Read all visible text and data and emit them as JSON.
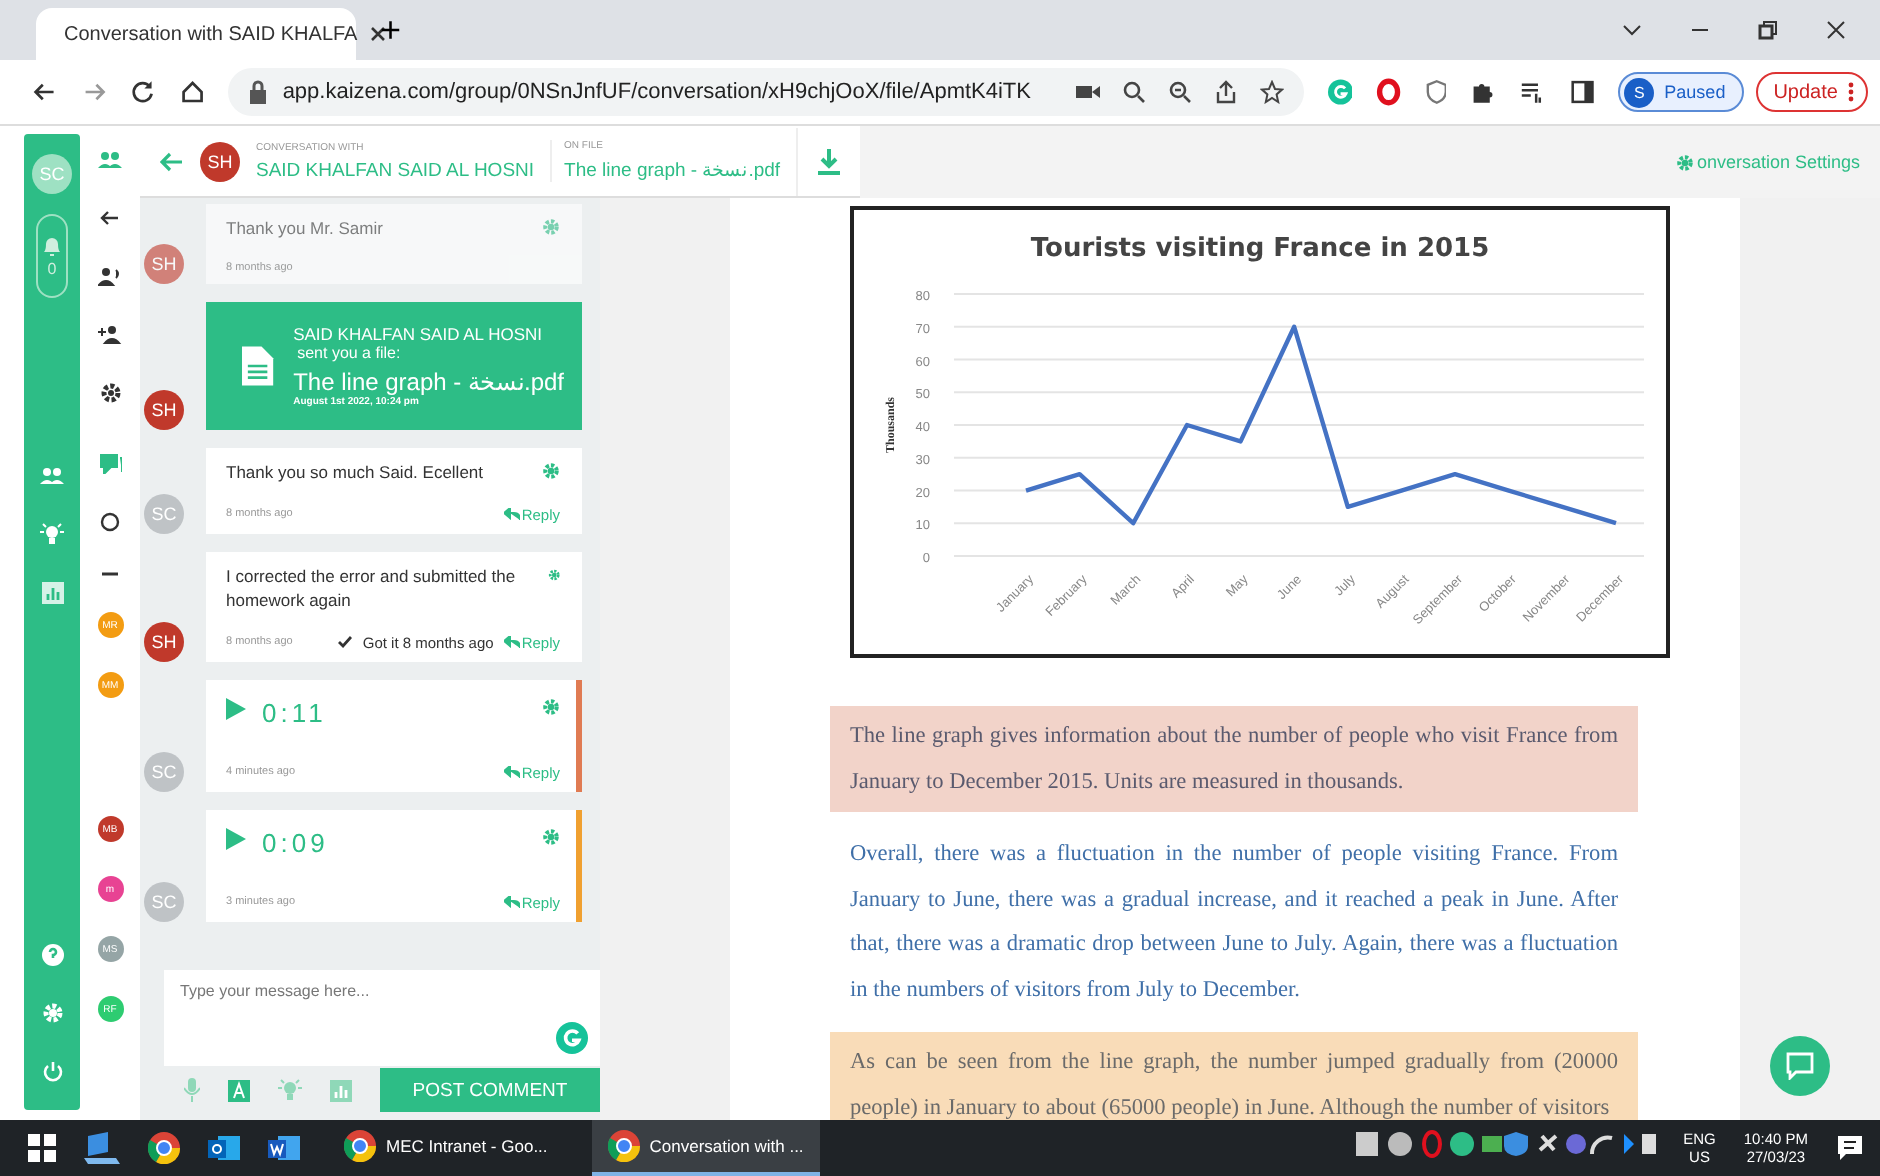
{
  "browser": {
    "tab_title": "Conversation with SAID KHALFA",
    "new_tab": "+",
    "url": "app.kaizena.com/group/0NSnJnfUF/conversation/xH9chjOoX/file/ApmtK4iTK",
    "profile_initial": "S",
    "profile_status": "Paused",
    "update": "Update"
  },
  "rail": {
    "avatar": "SC",
    "notification_count": "0"
  },
  "header": {
    "avatar": "SH",
    "with_label": "CONVERSATION WITH",
    "name": "SAID KHALFAN SAID AL HOSNI",
    "file_label": "ON FILE",
    "file": "The line graph - نسخة.pdf",
    "settings": "onversation Settings"
  },
  "members": [
    {
      "initials": "MR",
      "color": "#f39c12"
    },
    {
      "initials": "MM",
      "color": "#f39c12"
    },
    {
      "initials": "MB",
      "color": "#c0392b"
    },
    {
      "initials": "m",
      "color": "#e84393"
    },
    {
      "initials": "MS",
      "color": "#95a5a6"
    },
    {
      "initials": "RF",
      "color": "#2ecc71"
    }
  ],
  "messages": [
    {
      "kind": "text",
      "avatar": "SH",
      "faded": true,
      "text": "Thank you Mr. Samir",
      "time": "8 months ago"
    },
    {
      "kind": "file",
      "avatar": "SH",
      "sender": "SAID KHALFAN SAID AL HOSNI",
      "action": "sent you a file:",
      "file": "The line graph - نسخة.pdf",
      "date": "August 1st 2022, 10:24 pm"
    },
    {
      "kind": "text",
      "avatar": "SC",
      "faded": false,
      "text": "Thank you so much Said. Ecellent",
      "time": "8 months ago",
      "reply": "Reply"
    },
    {
      "kind": "text",
      "avatar": "SH",
      "faded": false,
      "text": "I corrected the error and submitted the homework again",
      "time": "8 months ago",
      "status": "Got it 8 months ago",
      "reply": "Reply"
    },
    {
      "kind": "audio",
      "avatar": "SC",
      "duration": "0:11",
      "time": "4 minutes ago",
      "reply": "Reply",
      "color": "#e07b53"
    },
    {
      "kind": "audio",
      "avatar": "SC",
      "duration": "0:09",
      "time": "3 minutes ago",
      "reply": "Reply",
      "color": "#f0a030"
    }
  ],
  "composer": {
    "placeholder": "Type your message here...",
    "post": "POST COMMENT"
  },
  "document": {
    "chart_data": {
      "type": "line",
      "title": "Tourists visiting France in 2015",
      "ylabel": "Thousands",
      "categories": [
        "January",
        "February",
        "March",
        "April",
        "May",
        "June",
        "July",
        "August",
        "September",
        "October",
        "November",
        "December"
      ],
      "grid": true,
      "series": [
        {
          "color": "#4472c4",
          "values": [
            20,
            25,
            10,
            40,
            35,
            70,
            15,
            20,
            25,
            20,
            15,
            10
          ]
        }
      ],
      "ylim": [
        0,
        80
      ],
      "yticks": [
        0,
        10,
        20,
        30,
        40,
        50,
        60,
        70,
        80
      ]
    },
    "paragraphs": [
      {
        "text": "The line graph gives information about the number of people who visit France from January to December 2015. Units are measured in thousands.",
        "color": "#f2d3c9",
        "kind": "introduction"
      },
      {
        "text": "Overall, there was a fluctuation in the number of people visiting France. From January to June, there was a gradual increase, and it reached a peak in June. After that, there was a dramatic drop between June to July. Again, there was a fluctuation in the numbers of visitors from July to December.",
        "color": "#ffffff",
        "kind": "overview"
      },
      {
        "text": "As can be seen from the line graph, the number jumped gradually from (20000 people) in January to about (65000 people) in June.  Although the number of visitors",
        "color": "#f9dcb8",
        "kind": "details"
      }
    ]
  },
  "taskbar": {
    "apps": [
      {
        "label": "MEC Intranet - Goo...",
        "selected": false
      },
      {
        "label": "Conversation with ...",
        "selected": true
      }
    ],
    "language": "ENG",
    "region": "US",
    "time": "10:40 PM",
    "date": "27/03/23"
  }
}
